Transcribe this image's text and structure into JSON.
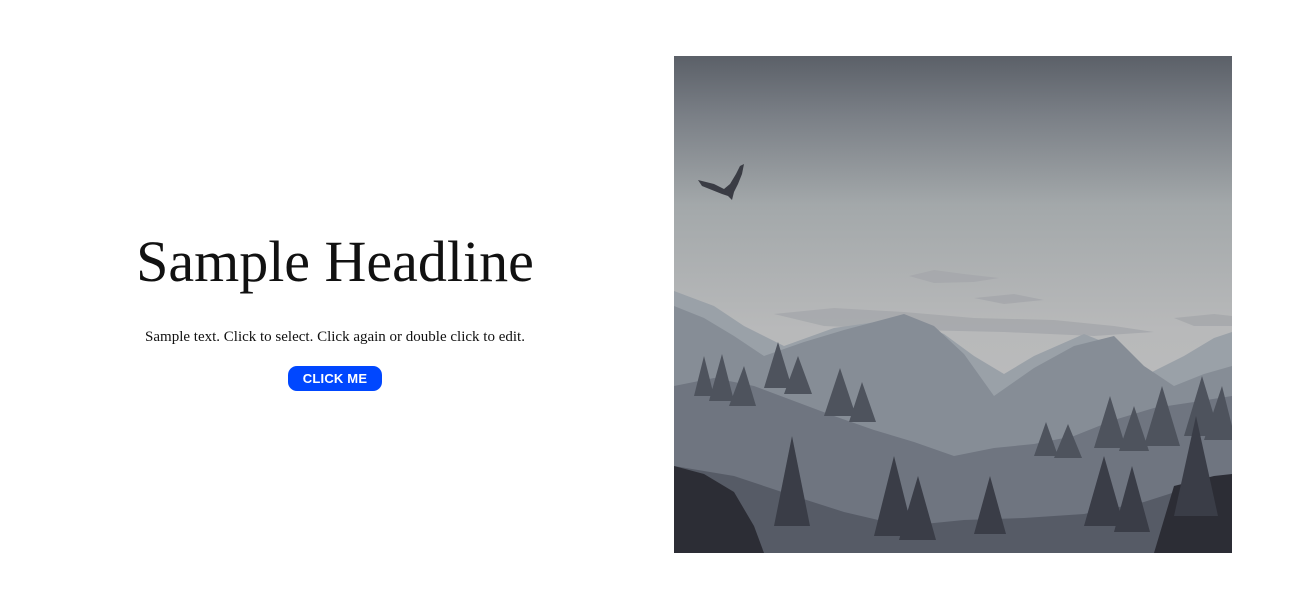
{
  "hero": {
    "headline": "Sample Headline",
    "body_text": "Sample text. Click to select. Click again or double click to edit.",
    "button_label": "CLICK ME"
  },
  "colors": {
    "button_bg": "#0047ff",
    "button_text": "#ffffff",
    "text": "#111111",
    "background": "#ffffff"
  },
  "image": {
    "subject_icon": "mountain-landscape-illustration",
    "bird_icon": "eagle-icon"
  }
}
